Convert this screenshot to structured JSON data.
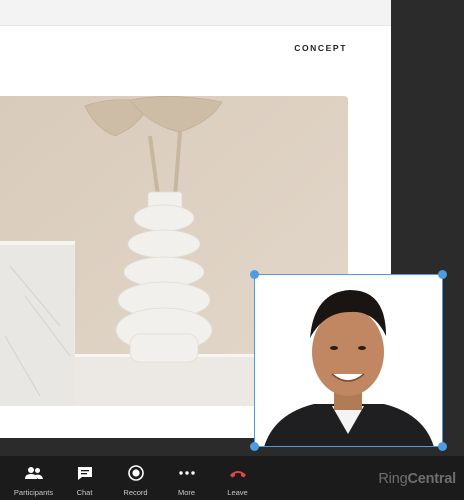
{
  "shared_screen": {
    "label": "CONCEPT"
  },
  "toolbar": {
    "items": [
      {
        "label": "Participants",
        "icon": "participants-icon"
      },
      {
        "label": "Chat",
        "icon": "chat-icon"
      },
      {
        "label": "Record",
        "icon": "record-icon"
      },
      {
        "label": "More",
        "icon": "more-icon"
      },
      {
        "label": "Leave",
        "icon": "leave-phone-icon"
      }
    ]
  },
  "brand": {
    "ring": "Ring",
    "central": "Central"
  },
  "colors": {
    "selection": "#4d9be0",
    "leave": "#e0474c",
    "toolbar_bg": "#1b1b1c"
  }
}
